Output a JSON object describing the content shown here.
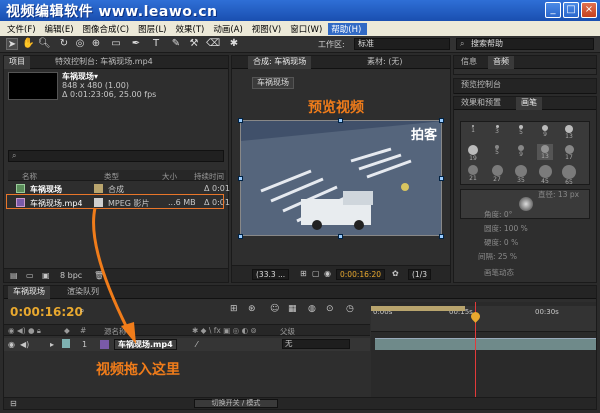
{
  "window": {
    "title": "视频编辑软件 www.leawo.cn",
    "buttons": [
      "_",
      "□",
      "×"
    ]
  },
  "menu": [
    "文件(F)",
    "编辑(E)",
    "图像合成(C)",
    "图层(L)",
    "效果(T)",
    "动画(A)",
    "视图(V)",
    "窗口(W)",
    "帮助(H)"
  ],
  "toolbar": {
    "workspace_label": "工作区:",
    "workspace_value": "标准",
    "search_placeholder": "搜索帮助"
  },
  "project": {
    "tabs": [
      "项目",
      "特效控制台: 车祸现场.mp4"
    ],
    "selected_name": "车祸现场▾",
    "selected_dims": "848 x 480 (1.00)",
    "selected_duration": "Δ 0:01:23:06, 25.00 fps",
    "headers": [
      "名称",
      "类型",
      "大小",
      "持续时间"
    ],
    "items": [
      {
        "name": "车祸现场",
        "type": "合成",
        "size": "",
        "duration": "Δ 0:01"
      },
      {
        "name": "车祸现场.mp4",
        "type": "MPEG 影片",
        "size": "...6 MB",
        "duration": "Δ 0:01"
      }
    ],
    "bpc": "8 bpc"
  },
  "viewer": {
    "tab_comp": "合成: 车祸现场",
    "tab_footage": "素材: (无)",
    "comp_label": "车祸现场",
    "annotation": "预览视频",
    "watermark": "拍客",
    "zoom": "(33.3 ...",
    "time": "0:00:16:20",
    "resolution": "(1/3"
  },
  "right": {
    "info_tabs": [
      "信息",
      "音频"
    ],
    "preview_tab": "预览控制台",
    "effect_tabs": [
      "效果和预置",
      "画笔"
    ],
    "brush_sizes": [
      "1",
      "3",
      "5",
      "9",
      "13",
      "19",
      "5",
      "9",
      "13",
      "17",
      "21",
      "27",
      "35",
      "45",
      "65"
    ],
    "brush_diameter_label": "直径",
    "brush_diameter": "13 px",
    "brush_props": [
      "角度: 0°",
      "圆度: 100 %",
      "硬度: 0 %",
      "间隔: 25 %"
    ],
    "brush_dynamics": "画笔动态"
  },
  "timeline": {
    "tabs": [
      "车祸现场",
      "渲染队列"
    ],
    "timecode": "0:00:16:20",
    "ruler_marks": [
      "0:00s",
      "00:15s",
      "00:30s"
    ],
    "headers": [
      "#",
      "源名称",
      "父级"
    ],
    "layer": {
      "index": "1",
      "name": "车祸现场.mp4",
      "parent": "无"
    },
    "annotation": "视频拖入这里",
    "switch_modes": "切换开关 / 模式"
  },
  "colors": {
    "accent": "#f07c1a",
    "timecode": "#e9a92f",
    "title_bar": "#2f6fd6"
  }
}
